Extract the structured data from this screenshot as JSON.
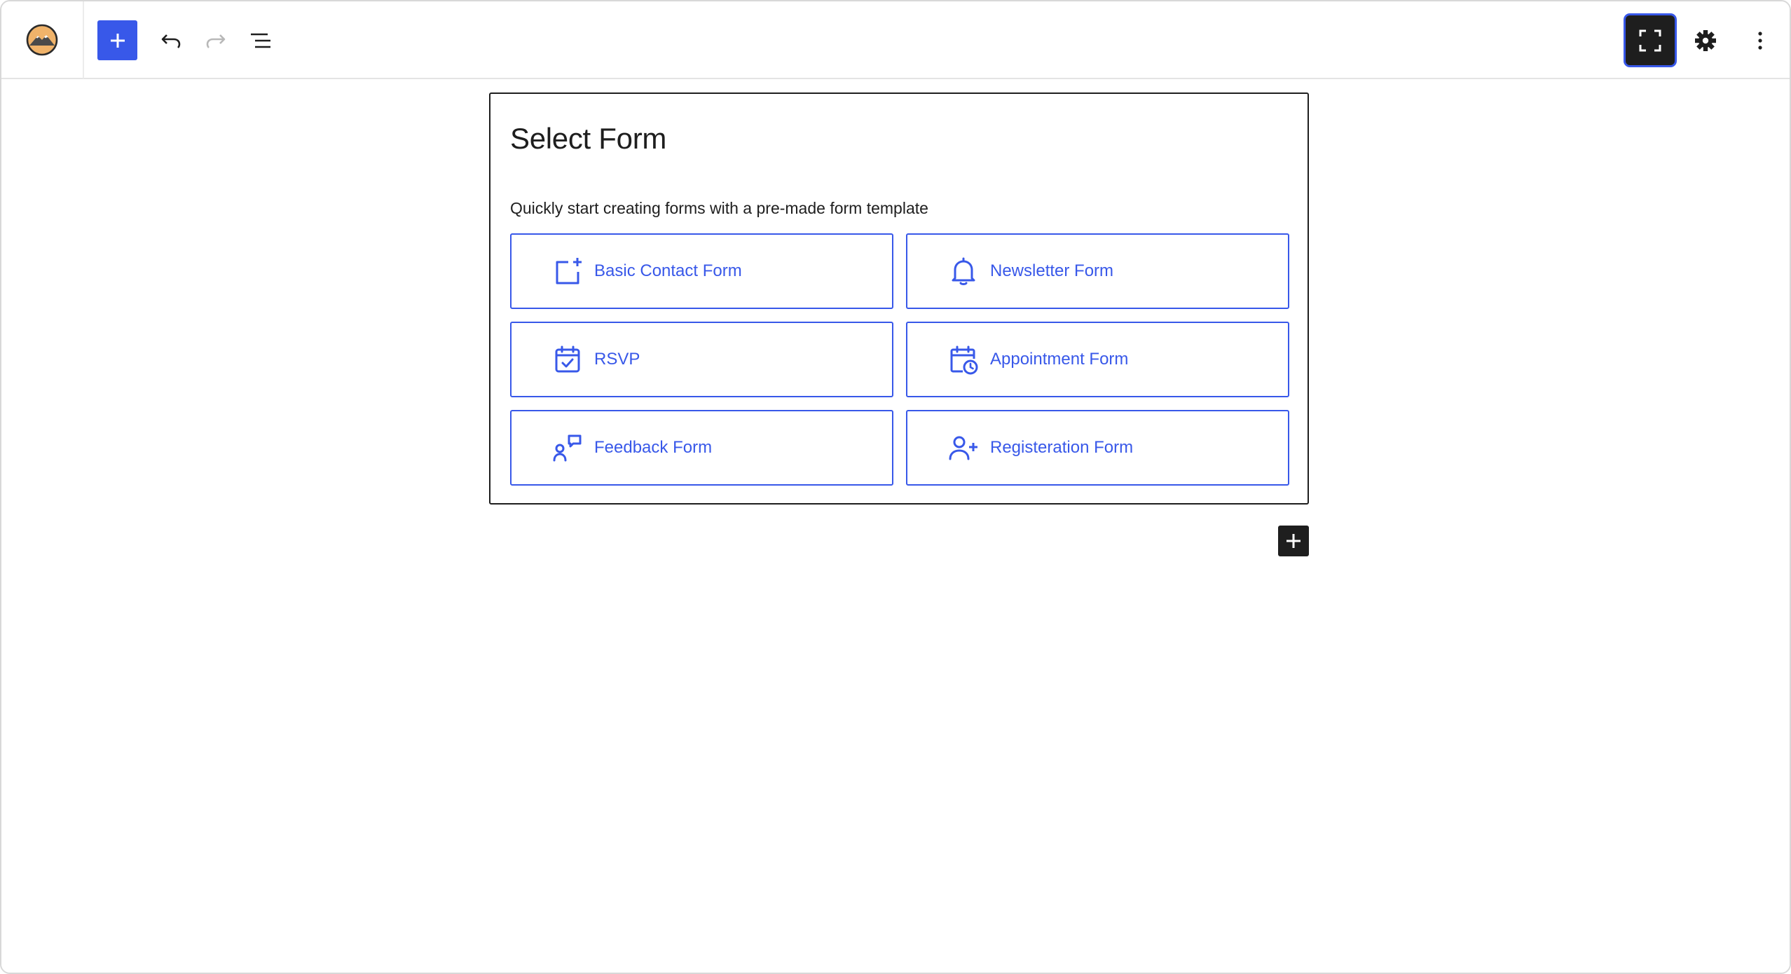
{
  "toolbar": {
    "site_logo_icon": "mountain-logo-icon",
    "inserter_icon": "plus-icon",
    "undo_icon": "undo-icon",
    "redo_icon": "redo-icon",
    "list_view_icon": "list-view-icon",
    "fullscreen_icon": "fullscreen-icon",
    "settings_icon": "gear-icon",
    "options_icon": "more-vertical-icon"
  },
  "form_selector": {
    "title": "Select Form",
    "subtitle": "Quickly start creating forms with a pre-made form template",
    "templates": [
      {
        "label": "Basic Contact Form",
        "icon": "form-add-icon"
      },
      {
        "label": "Newsletter Form",
        "icon": "bell-icon"
      },
      {
        "label": "RSVP",
        "icon": "calendar-check-icon"
      },
      {
        "label": "Appointment Form",
        "icon": "calendar-clock-icon"
      },
      {
        "label": "Feedback Form",
        "icon": "feedback-icon"
      },
      {
        "label": "Registeration Form",
        "icon": "user-add-icon"
      }
    ]
  },
  "add_block_icon": "plus-icon",
  "colors": {
    "accent": "#3858e9",
    "dark": "#1e1e1e",
    "border": "#e4e4e4",
    "logo_fill": "#f0b36a"
  }
}
